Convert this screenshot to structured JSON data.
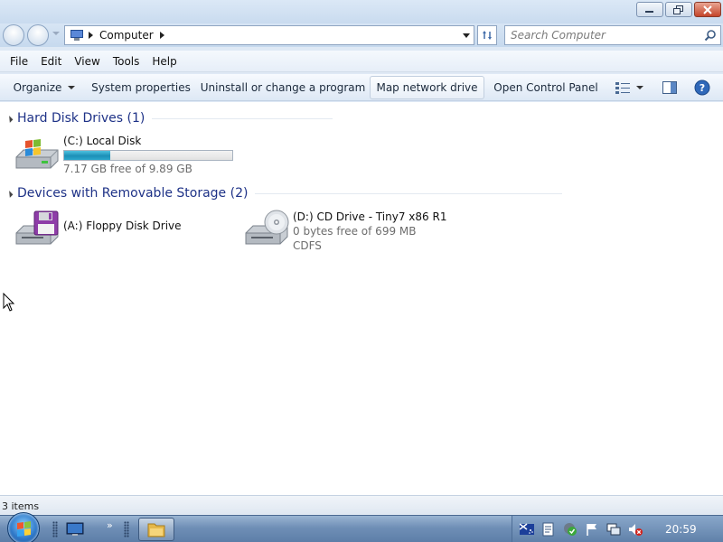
{
  "address": {
    "crumb": "Computer",
    "search_placeholder": "Search Computer"
  },
  "menu": [
    "File",
    "Edit",
    "View",
    "Tools",
    "Help"
  ],
  "commands": {
    "organize": "Organize",
    "system_properties": "System properties",
    "uninstall": "Uninstall or change a program",
    "map_drive": "Map network drive",
    "control_panel": "Open Control Panel"
  },
  "groups": {
    "hdd": "Hard Disk Drives (1)",
    "removable": "Devices with Removable Storage (2)"
  },
  "drives": {
    "c": {
      "name": "(C:) Local Disk",
      "free": "7.17 GB free of 9.89 GB",
      "used_fraction": 0.275
    },
    "a": {
      "name": "(A:) Floppy Disk Drive"
    },
    "d": {
      "name": "(D:) CD Drive - Tiny7 x86 R1",
      "free": "0 bytes free of 699 MB",
      "fs": "CDFS"
    }
  },
  "status": {
    "items": "3 items"
  },
  "taskbar": {
    "clock": "20:59"
  },
  "colors": {
    "group_title": "#1e3287",
    "bar_fill": "#1c8fb7"
  }
}
